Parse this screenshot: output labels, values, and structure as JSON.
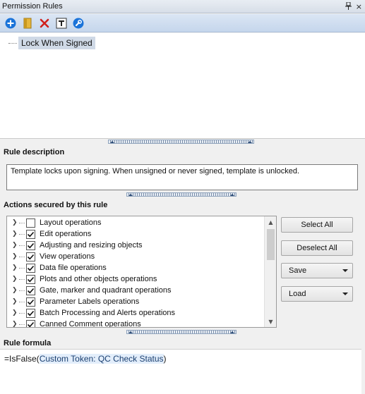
{
  "window": {
    "title": "Permission Rules",
    "controls": {
      "pin": "Ԅ",
      "close": "×"
    }
  },
  "toolbar": {
    "buttons": [
      {
        "icon": "add-icon",
        "color": "#1a73d9"
      },
      {
        "icon": "folder-icon",
        "color": "#d9a521"
      },
      {
        "icon": "delete-icon",
        "color": "#d0201c"
      },
      {
        "icon": "text-token-icon",
        "color": "#2b2b2b"
      },
      {
        "icon": "settings-wrench-icon",
        "color": "#1a73d9"
      }
    ]
  },
  "tree": {
    "items": [
      {
        "label": "Lock When Signed",
        "selected": true
      }
    ]
  },
  "rule_description": {
    "heading": "Rule description",
    "text": "Template locks upon signing. When unsigned or never signed, template is unlocked."
  },
  "actions": {
    "heading": "Actions secured by this rule",
    "items": [
      {
        "label": "Layout operations",
        "checked": false
      },
      {
        "label": "Edit operations",
        "checked": true
      },
      {
        "label": "Adjusting and resizing objects",
        "checked": true
      },
      {
        "label": "View operations",
        "checked": true
      },
      {
        "label": "Data file operations",
        "checked": true
      },
      {
        "label": "Plots and other objects operations",
        "checked": true
      },
      {
        "label": "Gate, marker and quadrant operations",
        "checked": true
      },
      {
        "label": "Parameter Labels operations",
        "checked": true
      },
      {
        "label": "Batch Processing and Alerts operations",
        "checked": true
      },
      {
        "label": "Canned Comment operations",
        "checked": true
      }
    ],
    "buttons": {
      "select_all": "Select All",
      "deselect_all": "Deselect All",
      "save": "Save",
      "load": "Load"
    }
  },
  "rule_formula": {
    "heading": "Rule formula",
    "prefix": "=IsFalse(",
    "token": "Custom Token: QC Check Status",
    "suffix": ")"
  }
}
